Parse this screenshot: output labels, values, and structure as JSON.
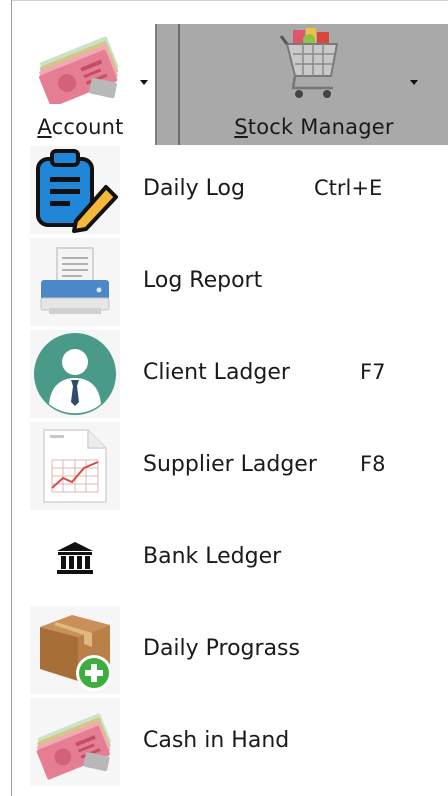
{
  "toolbar": {
    "account": {
      "label_first": "A",
      "label_rest": "ccount",
      "icon": "money-icon"
    },
    "stock_manager": {
      "label_first": "S",
      "label_rest": "tock Manager",
      "icon": "shopping-cart-icon"
    }
  },
  "menu": {
    "items": [
      {
        "label": "Daily Log",
        "shortcut": "Ctrl+E",
        "icon": "clipboard-edit-icon"
      },
      {
        "label": "Log Report",
        "shortcut": "",
        "icon": "printer-icon"
      },
      {
        "label": "Client Ladger",
        "shortcut": "F7",
        "icon": "client-user-icon"
      },
      {
        "label": "Supplier Ladger",
        "shortcut": "F8",
        "icon": "chart-sheet-icon"
      },
      {
        "label": "Bank Ledger",
        "shortcut": "",
        "icon": "bank-icon"
      },
      {
        "label": "Daily Prograss",
        "shortcut": "",
        "icon": "box-add-icon"
      },
      {
        "label": "Cash in Hand",
        "shortcut": "",
        "icon": "money-icon"
      }
    ]
  },
  "colors": {
    "toolbar_selected_bg": "#a9a9a9",
    "icon_tile_bg": "#f6f6f6",
    "clipboard_blue": "#1f86d8",
    "client_teal": "#4a9a8a",
    "box_brown": "#b27a40",
    "plus_green": "#3cae3c"
  }
}
